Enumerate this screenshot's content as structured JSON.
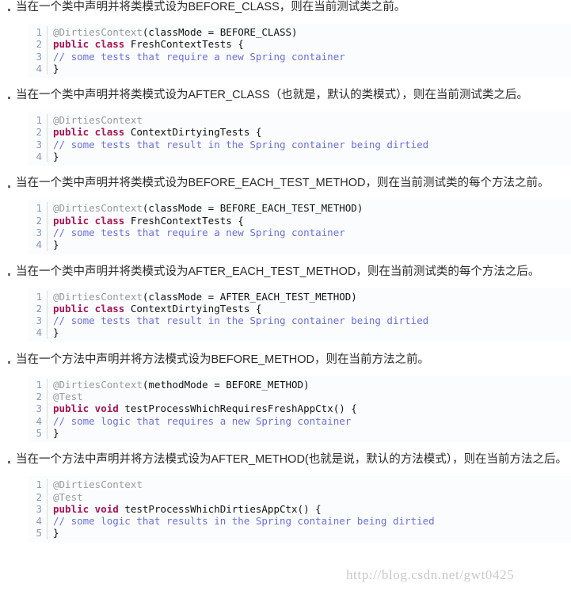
{
  "page": {
    "watermark": "http://blog.csdn.net/gwt0425",
    "bullet_glyph": "square-dot",
    "colors": {
      "background": "#ffffff",
      "text": "#2b2b2b",
      "code_background": "#fbfcfd",
      "gutter_text": "#8a9ab0",
      "gutter_rule": "#dcdcdc",
      "annotation": "#9b9b9b",
      "keyword": "#a31555",
      "comment": "#6a71d6",
      "code_plain": "#111111",
      "watermark": "#c9c9c9"
    }
  },
  "sections": [
    {
      "bullet": "当在一个类中声明并将类模式设为BEFORE_CLASS，则在当前测试类之前。",
      "code": {
        "line_numbers": [
          "1",
          "2",
          "3",
          "4"
        ],
        "lines": [
          [
            {
              "t": "@DirtiesContext",
              "c": "ann"
            },
            {
              "t": "(classMode = BEFORE_CLASS)",
              "c": "plain"
            }
          ],
          [
            {
              "t": "public class ",
              "c": "kw"
            },
            {
              "t": "FreshContextTests {",
              "c": "plain"
            }
          ],
          [
            {
              "t": "// some tests that require a new Spring container",
              "c": "com"
            }
          ],
          [
            {
              "t": "}",
              "c": "plain"
            }
          ]
        ]
      }
    },
    {
      "bullet": "当在一个类中声明并将类模式设为AFTER_CLASS（也就是，默认的类模式），则在当前测试类之后。",
      "code": {
        "line_numbers": [
          "1",
          "2",
          "3",
          "4"
        ],
        "lines": [
          [
            {
              "t": "@DirtiesContext",
              "c": "ann"
            }
          ],
          [
            {
              "t": "public class ",
              "c": "kw"
            },
            {
              "t": "ContextDirtyingTests {",
              "c": "plain"
            }
          ],
          [
            {
              "t": "// some tests that result in the Spring container being dirtied",
              "c": "com"
            }
          ],
          [
            {
              "t": "}",
              "c": "plain"
            }
          ]
        ]
      }
    },
    {
      "bullet": "当在一个类中声明并将类模式设为BEFORE_EACH_TEST_METHOD，则在当前测试类的每个方法之前。",
      "code": {
        "line_numbers": [
          "1",
          "2",
          "3",
          "4"
        ],
        "lines": [
          [
            {
              "t": "@DirtiesContext",
              "c": "ann"
            },
            {
              "t": "(classMode = BEFORE_EACH_TEST_METHOD)",
              "c": "plain"
            }
          ],
          [
            {
              "t": "public class ",
              "c": "kw"
            },
            {
              "t": "FreshContextTests {",
              "c": "plain"
            }
          ],
          [
            {
              "t": "// some tests that require a new Spring container",
              "c": "com"
            }
          ],
          [
            {
              "t": "}",
              "c": "plain"
            }
          ]
        ]
      }
    },
    {
      "bullet": "当在一个类中声明并将类模式设为AFTER_EACH_TEST_METHOD，则在当前测试类的每个方法之后。",
      "code": {
        "line_numbers": [
          "1",
          "2",
          "3",
          "4"
        ],
        "lines": [
          [
            {
              "t": "@DirtiesContext",
              "c": "ann"
            },
            {
              "t": "(classMode = AFTER_EACH_TEST_METHOD)",
              "c": "plain"
            }
          ],
          [
            {
              "t": "public class ",
              "c": "kw"
            },
            {
              "t": "ContextDirtyingTests {",
              "c": "plain"
            }
          ],
          [
            {
              "t": "// some tests that result in the Spring container being dirtied",
              "c": "com"
            }
          ],
          [
            {
              "t": "}",
              "c": "plain"
            }
          ]
        ]
      }
    },
    {
      "bullet": "当在一个方法中声明并将方法模式设为BEFORE_METHOD，则在当前方法之前。",
      "code": {
        "line_numbers": [
          "1",
          "2",
          "3",
          "4",
          "5"
        ],
        "lines": [
          [
            {
              "t": "@DirtiesContext",
              "c": "ann"
            },
            {
              "t": "(methodMode = BEFORE_METHOD)",
              "c": "plain"
            }
          ],
          [
            {
              "t": "@Test",
              "c": "ann"
            }
          ],
          [
            {
              "t": "public void ",
              "c": "kw"
            },
            {
              "t": "testProcessWhichRequiresFreshAppCtx() {",
              "c": "plain"
            }
          ],
          [
            {
              "t": "// some logic that requires a new Spring container",
              "c": "com"
            }
          ],
          [
            {
              "t": "}",
              "c": "plain"
            }
          ]
        ]
      }
    },
    {
      "bullet": "当在一个方法中声明并将方法模式设为AFTER_METHOD(也就是说，默认的方法模式），则在当前方法之后。",
      "code": {
        "line_numbers": [
          "1",
          "2",
          "3",
          "4",
          "5"
        ],
        "lines": [
          [
            {
              "t": "@DirtiesContext",
              "c": "ann"
            }
          ],
          [
            {
              "t": "@Test",
              "c": "ann"
            }
          ],
          [
            {
              "t": "public void ",
              "c": "kw"
            },
            {
              "t": "testProcessWhichDirtiesAppCtx() {",
              "c": "plain"
            }
          ],
          [
            {
              "t": "// some logic that results in the Spring container being dirtied",
              "c": "com"
            }
          ],
          [
            {
              "t": "}",
              "c": "plain"
            }
          ]
        ]
      }
    }
  ]
}
